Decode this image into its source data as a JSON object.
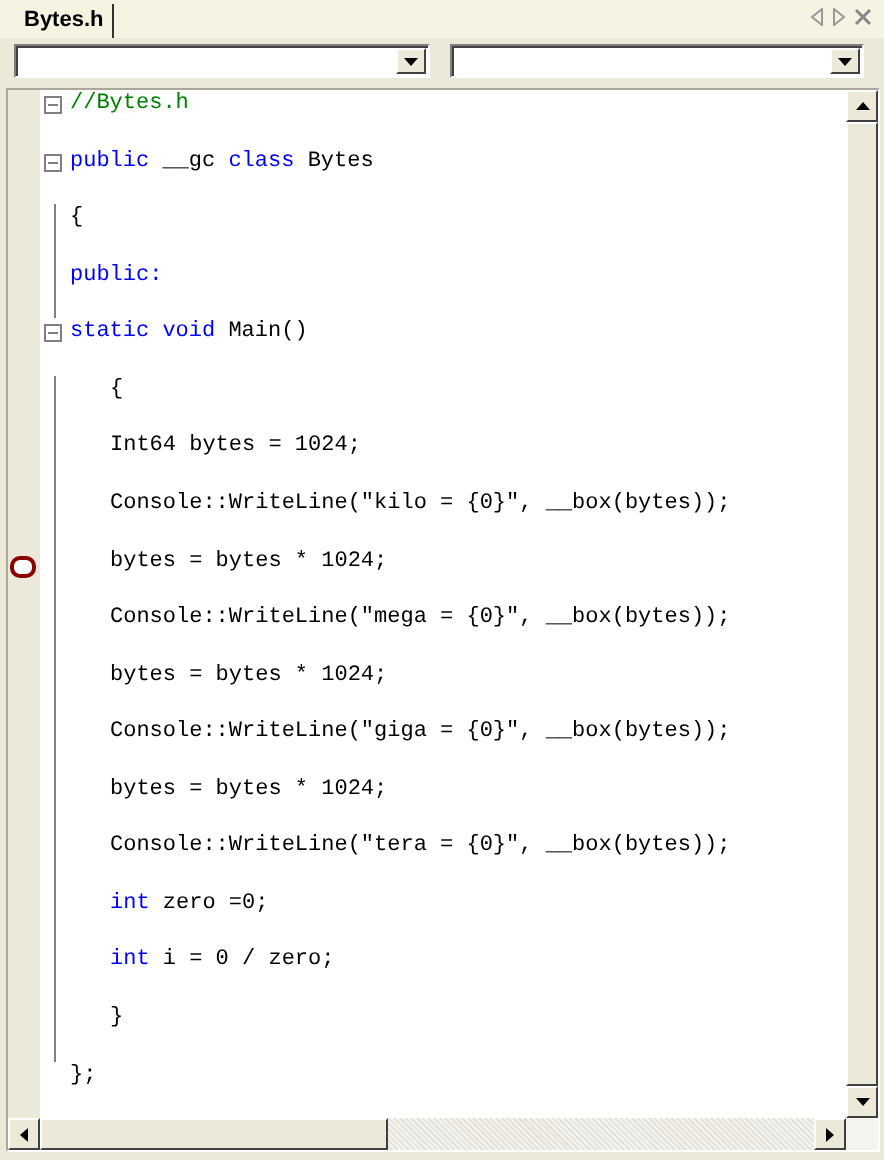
{
  "tabs": [
    {
      "label": "Bytes.h",
      "selected": true
    }
  ],
  "navigation_bar": {
    "dropdowns": [
      {
        "kind": "combo"
      },
      {
        "kind": "combo"
      }
    ]
  },
  "editor": {
    "lines": [
      {
        "indented": false,
        "foldable": true,
        "breakpoint": false,
        "segments": [
          {
            "text": "//Bytes.h",
            "kind": "comment"
          }
        ]
      },
      {
        "indented": false,
        "foldable": true,
        "breakpoint": false,
        "segments": [
          {
            "text": "public",
            "kind": "keyword"
          },
          {
            "text": "__gc",
            "kind": "plain"
          },
          {
            "text": "class",
            "kind": "keyword"
          },
          {
            "text": "Bytes",
            "kind": "plain"
          }
        ]
      },
      {
        "indented": false,
        "foldable": false,
        "breakpoint": false,
        "segments": [
          {
            "text": "{",
            "kind": "plain"
          }
        ]
      },
      {
        "indented": false,
        "foldable": false,
        "breakpoint": false,
        "segments": [
          {
            "text": "public:",
            "kind": "keyword"
          }
        ]
      },
      {
        "indented": false,
        "foldable": true,
        "breakpoint": false,
        "segments": [
          {
            "text": "static",
            "kind": "keyword"
          },
          {
            "text": "void",
            "kind": "keyword"
          },
          {
            "text": "Main()",
            "kind": "plain"
          }
        ]
      },
      {
        "indented": true,
        "foldable": false,
        "breakpoint": false,
        "segments": [
          {
            "text": "{",
            "kind": "plain"
          }
        ]
      },
      {
        "indented": true,
        "foldable": false,
        "breakpoint": false,
        "segments": [
          {
            "text": "Int64 bytes = 1024;",
            "kind": "plain"
          }
        ]
      },
      {
        "indented": true,
        "foldable": false,
        "breakpoint": false,
        "segments": [
          {
            "text": "Console::WriteLine(\"kilo = {0}\", __box(bytes));",
            "kind": "plain"
          }
        ]
      },
      {
        "indented": true,
        "foldable": false,
        "breakpoint": true,
        "segments": [
          {
            "text": "bytes = bytes * 1024;",
            "kind": "plain"
          }
        ]
      },
      {
        "indented": true,
        "foldable": false,
        "breakpoint": false,
        "segments": [
          {
            "text": "Console::WriteLine(\"mega = {0}\", __box(bytes));",
            "kind": "plain"
          }
        ]
      },
      {
        "indented": true,
        "foldable": false,
        "breakpoint": false,
        "segments": [
          {
            "text": "bytes = bytes * 1024;",
            "kind": "plain"
          }
        ]
      },
      {
        "indented": true,
        "foldable": false,
        "breakpoint": false,
        "segments": [
          {
            "text": "Console::WriteLine(\"giga = {0}\", __box(bytes));",
            "kind": "plain"
          }
        ]
      },
      {
        "indented": true,
        "foldable": false,
        "breakpoint": false,
        "segments": [
          {
            "text": "bytes = bytes * 1024;",
            "kind": "plain"
          }
        ]
      },
      {
        "indented": true,
        "foldable": false,
        "breakpoint": false,
        "segments": [
          {
            "text": "Console::WriteLine(\"tera = {0}\", __box(bytes));",
            "kind": "plain"
          }
        ]
      },
      {
        "indented": true,
        "foldable": false,
        "breakpoint": false,
        "segments": [
          {
            "text": "int",
            "kind": "keyword"
          },
          {
            "text": "zero =0;",
            "kind": "plain"
          }
        ]
      },
      {
        "indented": true,
        "foldable": false,
        "breakpoint": false,
        "segments": [
          {
            "text": "int",
            "kind": "keyword"
          },
          {
            "text": "i = 0 / zero;",
            "kind": "plain"
          }
        ]
      },
      {
        "indented": true,
        "foldable": false,
        "breakpoint": false,
        "segments": [
          {
            "text": "}",
            "kind": "plain"
          }
        ]
      },
      {
        "indented": false,
        "foldable": false,
        "breakpoint": false,
        "segments": [
          {
            "text": "};",
            "kind": "plain"
          }
        ]
      }
    ]
  }
}
